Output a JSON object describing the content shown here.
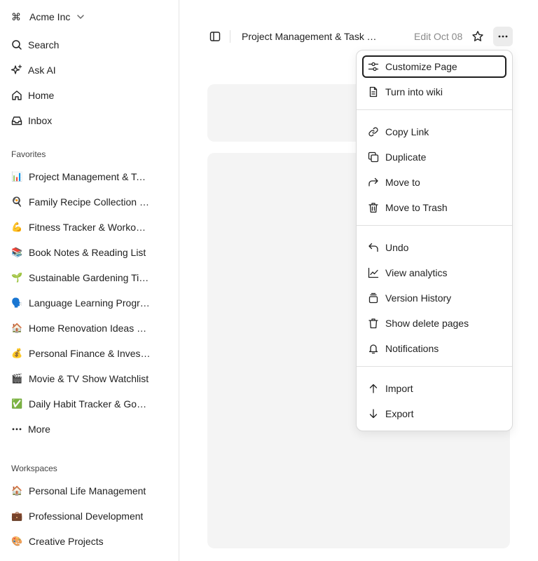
{
  "workspace": {
    "name": "Acme Inc",
    "symbol": "⌘"
  },
  "nav": [
    {
      "id": "search",
      "label": "Search",
      "icon": "search-icon"
    },
    {
      "id": "ask-ai",
      "label": "Ask AI",
      "icon": "sparkle-icon"
    },
    {
      "id": "home",
      "label": "Home",
      "icon": "home-icon"
    },
    {
      "id": "inbox",
      "label": "Inbox",
      "icon": "inbox-icon"
    }
  ],
  "favorites": {
    "label": "Favorites",
    "items": [
      {
        "emoji": "📊",
        "label": "Project Management & Task Tracking"
      },
      {
        "emoji": "🍳",
        "label": "Family Recipe Collection & Meal Planning"
      },
      {
        "emoji": "💪",
        "label": "Fitness Tracker & Workout Routines"
      },
      {
        "emoji": "📚",
        "label": "Book Notes & Reading List"
      },
      {
        "emoji": "🌱",
        "label": "Sustainable Gardening Tips & Plant Care"
      },
      {
        "emoji": "🗣️",
        "label": "Language Learning Progress"
      },
      {
        "emoji": "🏠",
        "label": "Home Renovation Ideas & Budget"
      },
      {
        "emoji": "💰",
        "label": "Personal Finance & Investment Portfolio"
      },
      {
        "emoji": "🎬",
        "label": "Movie & TV Show Watchlist"
      },
      {
        "emoji": "✅",
        "label": "Daily Habit Tracker & Goal Setting"
      }
    ],
    "more_label": "More"
  },
  "workspaces": {
    "label": "Workspaces",
    "items": [
      {
        "emoji": "🏠",
        "label": "Personal Life Management"
      },
      {
        "emoji": "💼",
        "label": "Professional Development"
      },
      {
        "emoji": "🎨",
        "label": "Creative Projects"
      }
    ]
  },
  "topbar": {
    "page_title": "Project Management & Task Tracking",
    "edit_label": "Edit Oct 08"
  },
  "menu": {
    "groups": [
      [
        {
          "label": "Customize Page",
          "icon": "sliders-icon",
          "focused": true
        },
        {
          "label": "Turn into wiki",
          "icon": "document-icon"
        }
      ],
      [
        {
          "label": "Copy Link",
          "icon": "link-icon"
        },
        {
          "label": "Duplicate",
          "icon": "copy-icon"
        },
        {
          "label": "Move to",
          "icon": "arrow-forward-icon"
        },
        {
          "label": "Move to Trash",
          "icon": "trash-icon"
        }
      ],
      [
        {
          "label": "Undo",
          "icon": "undo-icon"
        },
        {
          "label": "View analytics",
          "icon": "chart-line-icon"
        },
        {
          "label": "Version History",
          "icon": "layers-icon"
        },
        {
          "label": "Show delete pages",
          "icon": "trash-icon"
        },
        {
          "label": "Notifications",
          "icon": "bell-icon"
        }
      ],
      [
        {
          "label": "Import",
          "icon": "arrow-up-icon"
        },
        {
          "label": "Export",
          "icon": "arrow-down-icon"
        }
      ]
    ]
  }
}
